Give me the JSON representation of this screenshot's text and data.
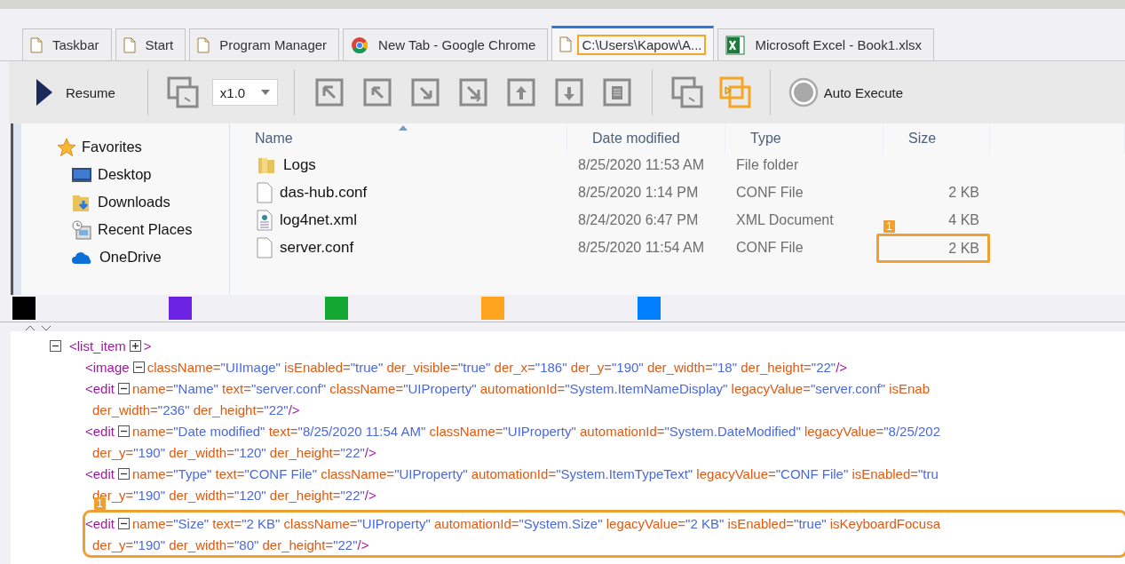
{
  "tabs": [
    {
      "label": "Taskbar",
      "kind": "page",
      "selected": false
    },
    {
      "label": "Start",
      "kind": "page",
      "selected": false
    },
    {
      "label": "Program Manager",
      "kind": "page",
      "selected": false
    },
    {
      "label": "New Tab - Google Chrome",
      "kind": "chrome",
      "selected": false
    },
    {
      "label": "C:\\Users\\Kapow\\A...",
      "kind": "page",
      "selected": true
    },
    {
      "label": "Microsoft Excel - Book1.xlsx",
      "kind": "excel",
      "selected": false
    }
  ],
  "toolbar": {
    "resume": "Resume",
    "speed": "x1.0",
    "tools": [
      {
        "kind": "window",
        "active": false
      },
      {
        "kind": "speed"
      },
      {
        "kind": "first"
      },
      {
        "kind": "prev"
      },
      {
        "kind": "next"
      },
      {
        "kind": "last"
      },
      {
        "kind": "up"
      },
      {
        "kind": "down"
      },
      {
        "kind": "page"
      },
      {
        "kind": "window",
        "active": false
      },
      {
        "kind": "window",
        "active": true
      },
      {
        "kind": "auto",
        "label": "Auto Execute",
        "selected": false
      }
    ]
  },
  "explorer": {
    "sidebar": [
      {
        "label": "Favorites",
        "kind": "star"
      },
      {
        "label": "Desktop",
        "kind": "desktop"
      },
      {
        "label": "Downloads",
        "kind": "downloads"
      },
      {
        "label": "Recent Places",
        "kind": "recent"
      },
      {
        "label": "OneDrive",
        "kind": "cloud"
      }
    ],
    "columns": [
      {
        "label": "Name",
        "sorted": true
      },
      {
        "label": "Date modified",
        "sorted": false
      },
      {
        "label": "Type",
        "sorted": false
      },
      {
        "label": "Size",
        "sorted": false
      }
    ],
    "rows": [
      {
        "name": "Logs",
        "kind": "folder",
        "date": "8/25/2020 11:53 AM",
        "type": "File folder",
        "highlighted": false
      },
      {
        "name": "das-hub.conf",
        "kind": "file",
        "date": "8/25/2020 1:14 PM",
        "type": "CONF File",
        "size": "2 KB",
        "highlighted": false
      },
      {
        "name": "log4net.xml",
        "kind": "xml",
        "date": "8/24/2020 6:47 PM",
        "type": "XML Document",
        "size": "4 KB",
        "highlighted": false
      },
      {
        "name": "server.conf",
        "kind": "file",
        "date": "8/25/2020 11:54 AM",
        "type": "CONF File",
        "size": "2 KB",
        "highlighted": true,
        "badge": "1"
      }
    ]
  },
  "swatches": [
    {
      "color": "#000000"
    },
    {
      "color": "#6b22e3"
    },
    {
      "color": "#12a832"
    },
    {
      "color": "#ffa41c"
    },
    {
      "color": "#0080ff"
    }
  ],
  "xml": {
    "tag": "<list_item",
    "close": ">",
    "expanded": true,
    "attrs_expanded": false,
    "children": [
      {
        "tag": "<image",
        "attrs_expanded": true,
        "highlighted": false,
        "lines": [
          {
            "attrs": [
              {
                "name": "className=",
                "value": "\"UIImage\""
              },
              {
                "name": "isEnabled=",
                "value": "\"true\""
              },
              {
                "name": "der_visible=",
                "value": "\"true\""
              },
              {
                "name": "der_x=",
                "value": "\"186\""
              },
              {
                "name": "der_y=",
                "value": "\"190\""
              },
              {
                "name": "der_width=",
                "value": "\"18\""
              },
              {
                "name": "der_height=",
                "value": "\"22\""
              }
            ],
            "end": "/>"
          }
        ]
      },
      {
        "tag": "<edit",
        "attrs_expanded": true,
        "highlighted": false,
        "lines": [
          {
            "attrs": [
              {
                "name": "name=",
                "value": "\"Name\""
              },
              {
                "name": "text=",
                "value": "\"server.conf\""
              },
              {
                "name": "className=",
                "value": "\"UIProperty\""
              },
              {
                "name": "automationId=",
                "value": "\"System.ItemNameDisplay\""
              },
              {
                "name": "legacyValue=",
                "value": "\"server.conf\""
              },
              {
                "name": "isEnab"
              }
            ]
          },
          {
            "attrs": [
              {
                "name": "der_width=",
                "value": "\"236\""
              },
              {
                "name": "der_height=",
                "value": "\"22\""
              }
            ],
            "end": "/>"
          }
        ]
      },
      {
        "tag": "<edit",
        "attrs_expanded": true,
        "highlighted": false,
        "lines": [
          {
            "attrs": [
              {
                "name": "name=",
                "value": "\"Date modified\""
              },
              {
                "name": "text=",
                "value": "\"8/25/2020 11:54 AM\""
              },
              {
                "name": "className=",
                "value": "\"UIProperty\""
              },
              {
                "name": "automationId=",
                "value": "\"System.DateModified\""
              },
              {
                "name": "legacyValue=",
                "value": "\"8/25/202"
              }
            ]
          },
          {
            "attrs": [
              {
                "name": "der_y=",
                "value": "\"190\""
              },
              {
                "name": "der_width=",
                "value": "\"120\""
              },
              {
                "name": "der_height=",
                "value": "\"22\""
              }
            ],
            "end": "/>"
          }
        ]
      },
      {
        "tag": "<edit",
        "attrs_expanded": true,
        "highlighted": false,
        "lines": [
          {
            "attrs": [
              {
                "name": "name=",
                "value": "\"Type\""
              },
              {
                "name": "text=",
                "value": "\"CONF File\""
              },
              {
                "name": "className=",
                "value": "\"UIProperty\""
              },
              {
                "name": "automationId=",
                "value": "\"System.ItemTypeText\""
              },
              {
                "name": "legacyValue=",
                "value": "\"CONF File\""
              },
              {
                "name": "isEnabled=",
                "value": "\"tru"
              }
            ]
          },
          {
            "attrs": [
              {
                "name": "der_y=",
                "value": "\"190\""
              },
              {
                "name": "der_width=",
                "value": "\"120\""
              },
              {
                "name": "der_height=",
                "value": "\"22\""
              }
            ],
            "end": "/>"
          }
        ]
      },
      {
        "tag": "<edit",
        "attrs_expanded": true,
        "highlighted": true,
        "badge": "1",
        "lines": [
          {
            "attrs": [
              {
                "name": "name=",
                "value": "\"Size\""
              },
              {
                "name": "text=",
                "value": "\"2 KB\""
              },
              {
                "name": "className=",
                "value": "\"UIProperty\""
              },
              {
                "name": "automationId=",
                "value": "\"System.Size\""
              },
              {
                "name": "legacyValue=",
                "value": "\"2 KB\""
              },
              {
                "name": "isEnabled=",
                "value": "\"true\""
              },
              {
                "name": "isKeyboardFocusa"
              }
            ]
          },
          {
            "attrs": [
              {
                "name": "der_y=",
                "value": "\"190\""
              },
              {
                "name": "der_width=",
                "value": "\"80\""
              },
              {
                "name": "der_height=",
                "value": "\"22\""
              }
            ],
            "end": "/>"
          }
        ]
      }
    ]
  }
}
